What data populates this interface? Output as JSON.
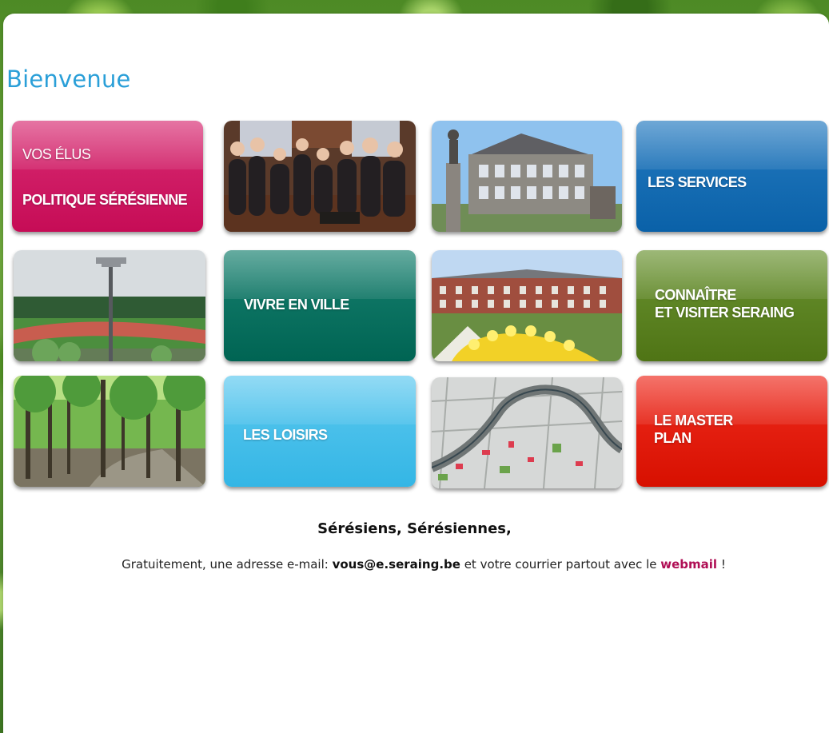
{
  "page": {
    "title": "Bienvenue"
  },
  "tiles": {
    "vos_elus": {
      "line1": "VOS ÉLUS",
      "line2": "POLITIQUE SÉRÉSIENNE"
    },
    "services": {
      "label": "LES SERVICES"
    },
    "vivre": {
      "label": "VIVRE EN VILLE"
    },
    "connaitre": {
      "line1": "CONNAÎTRE",
      "line2": "ET VISITER SERAING"
    },
    "loisirs": {
      "label": "LES LOISIRS"
    },
    "master": {
      "line1": "LE MASTER",
      "line2": "PLAN"
    }
  },
  "welcome": {
    "heading": "Sérésiens, Sérésiennes,",
    "intro": "Gratuitement, une adresse e-mail: ",
    "email": "vous@e.seraing.be",
    "middle": " et votre courrier partout avec le ",
    "webmail": "webmail",
    "end": " !"
  },
  "colors": {
    "title": "#2a9fd8",
    "pink_tile": "#c60c56",
    "blue_tile": "#0a61a8",
    "teal_tile": "#006453",
    "olive_tile": "#4f7415",
    "sky_tile": "#34b6e5",
    "red_tile": "#d71000",
    "webmail_link": "#b00f55"
  }
}
